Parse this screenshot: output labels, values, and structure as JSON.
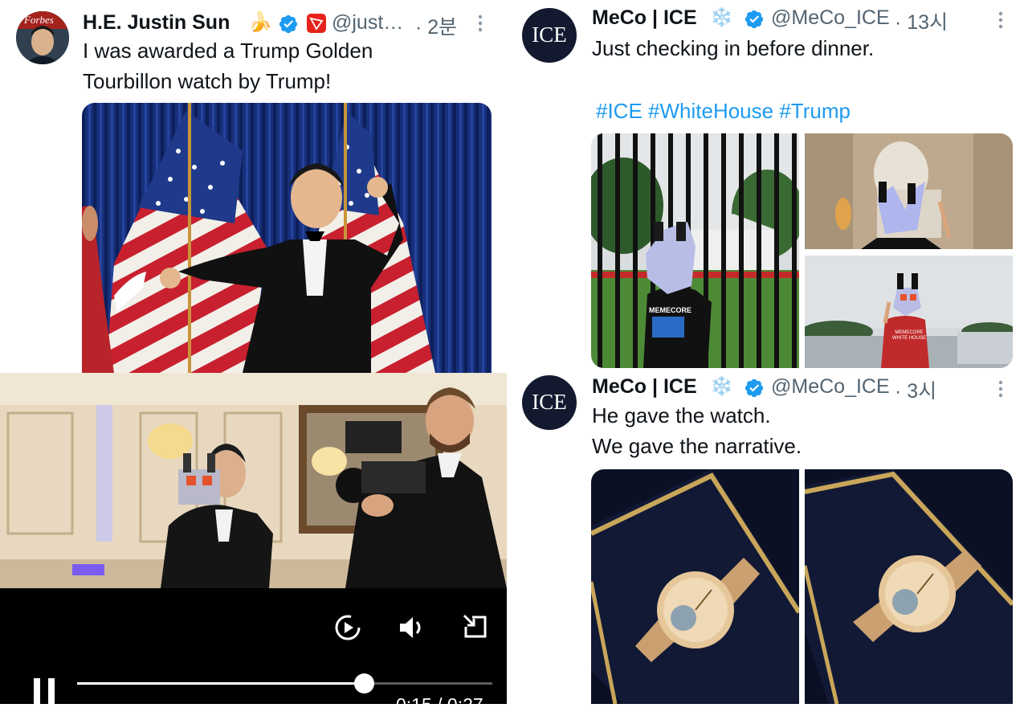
{
  "tweet_left": {
    "display_name": "H.E. Justin Sun",
    "emoji": "🍌",
    "handle": "@just…",
    "time": "· 2분",
    "avatar_text": "Forbes",
    "text_line1": "I was awarded a Trump Golden",
    "text_line2": "Tourbillon watch by Trump!"
  },
  "video_player": {
    "time": "0:15 / 0:27",
    "progress": 0.69,
    "icons": [
      "replay-icon",
      "volume-icon",
      "minimize-icon",
      "pause-icon"
    ]
  },
  "tweet_right_1": {
    "display_name": "MeCo | ICE",
    "emoji": "❄️",
    "handle": "@MeCo_ICE",
    "time": "· 13시",
    "avatar_text": "ICE",
    "text": "Just checking in before dinner.",
    "hashtags": "#ICE #WhiteHouse #Trump"
  },
  "tweet_right_2": {
    "display_name": "MeCo | ICE",
    "emoji": "❄️",
    "handle": "@MeCo_ICE",
    "time": "· 3시",
    "avatar_text": "ICE",
    "text_line1": "He gave the watch.",
    "text_line2": "We gave the narrative."
  },
  "photo_captions": {
    "shirt_text": "MEMECORE",
    "shirt_text_2": "MEMECORE WHITE HOUSE"
  },
  "colors": {
    "verified": "#1d9bf0",
    "hashtag": "#1d9bf0",
    "handle": "#536471"
  }
}
